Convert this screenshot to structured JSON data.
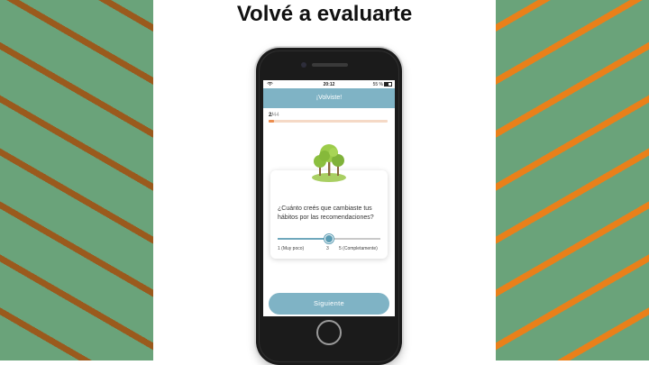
{
  "headline": "Volvé a evaluarte",
  "colors": {
    "stripe_left": "#9a5a1d",
    "stripe_right": "#e9801a",
    "background_green": "#6aa37a",
    "app_accent": "#7fb3c5",
    "progress_accent": "#ec8d4e"
  },
  "status_bar": {
    "time": "20:12",
    "battery": "55 %"
  },
  "app_bar": {
    "title": "¡Volviste!"
  },
  "progress": {
    "current": "2",
    "separator": "/",
    "total": "44"
  },
  "question": {
    "text": "¿Cuánto creés que cambiaste tus hábitos por las recomendaciones?",
    "illustration": "trees-illustration"
  },
  "slider": {
    "min_label": "1 (Muy poco)",
    "mid_label": "3",
    "max_label": "5 (Completamente)",
    "value": 3
  },
  "next_button": {
    "label": "Siguiente"
  }
}
